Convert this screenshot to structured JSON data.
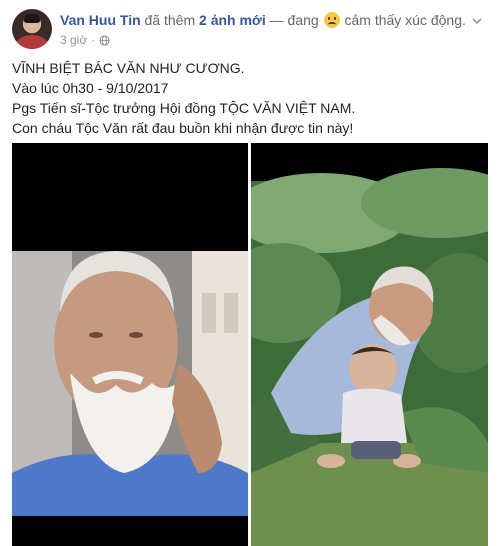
{
  "post": {
    "author_name": "Van Huu Tin",
    "action_text": "đã thêm",
    "photos_text": "2 ảnh mới",
    "feeling_prefix": "— đang",
    "feeling_text": "cảm thấy xúc động.",
    "timestamp": "3 giờ",
    "separator": "·",
    "lines": [
      "VĨNH BIỆT BÁC VĂN NHƯ CƯƠNG.",
      "Vào lúc 0h30 - 9/10/2017",
      "Pgs Tiến sĩ-Tộc trưởng Hội đồng TỘC VĂN VIỆT NAM.",
      "Con cháu Tộc Văn rất đau buồn khi nhận được tin này!"
    ]
  },
  "icons": {
    "feeling": "sad-face-icon",
    "privacy": "globe-icon",
    "menu": "chevron-down-icon"
  },
  "colors": {
    "author_link": "#365899",
    "meta_gray": "#90949c",
    "body_text": "#1d2129"
  }
}
